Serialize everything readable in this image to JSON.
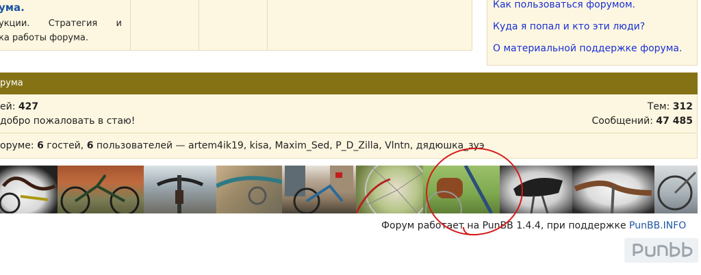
{
  "forum_row": {
    "title": "ума.",
    "desc_line1_left": "укции.",
    "desc_line1_mid": "Стратегия",
    "desc_line1_right": "и",
    "desc_line2": "ка работы форума."
  },
  "help": {
    "links": [
      "Как пользоваться форумом.",
      "Куда я попал и кто эти люди?",
      "О материальной поддержке форума."
    ]
  },
  "stats": {
    "header": "рума",
    "users_label": "ей:",
    "users_value": "427",
    "welcome": "добро пожаловать в стаю!",
    "topics_label": "Тем:",
    "topics_value": "312",
    "posts_label": "Сообщений:",
    "posts_value": "47 485",
    "online_prefix": "оруме:",
    "guests_count": "6",
    "guests_label": "гостей,",
    "users_count": "6",
    "users_online_label": "пользователей —",
    "online_users": "artem4ik19, kisa, Maxim_Sed, P_D_Zilla, Vlntn, дядюшка_зуэ"
  },
  "footer": {
    "text": "Форум работает на PunBB 1.4.4, при поддержке",
    "link": "PunBB.INFO",
    "logo": "PunBB"
  },
  "colors": {
    "header_bg": "#857215",
    "panel_bg": "#fdf7e1",
    "link": "#1a2fd4",
    "annotation": "#d41a1a"
  }
}
